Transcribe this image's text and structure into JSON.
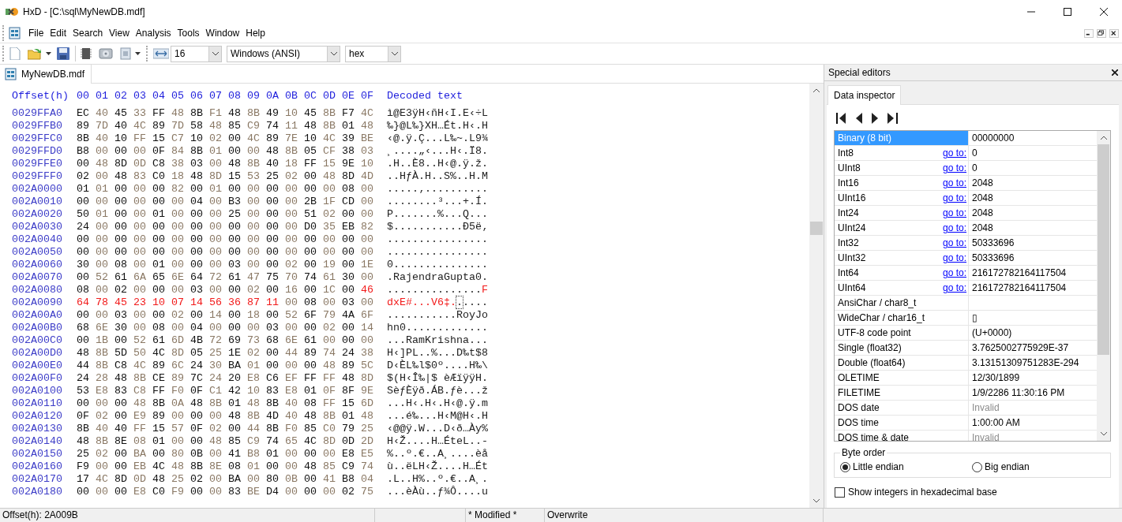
{
  "window": {
    "title": "HxD - [C:\\sql\\MyNewDB.mdf]"
  },
  "menu": [
    "File",
    "Edit",
    "Search",
    "View",
    "Analysis",
    "Tools",
    "Window",
    "Help"
  ],
  "toolbar": {
    "bytes_per_row": "16",
    "encoding": "Windows (ANSI)",
    "display": "hex"
  },
  "document_tabs": [
    {
      "label": "MyNewDB.mdf",
      "selected": true
    }
  ],
  "hex_view": {
    "header": {
      "offset": "Offset(h)",
      "columns": [
        "00",
        "01",
        "02",
        "03",
        "04",
        "05",
        "06",
        "07",
        "08",
        "09",
        "0A",
        "0B",
        "0C",
        "0D",
        "0E",
        "0F"
      ],
      "decoded": "Decoded text"
    },
    "rows": [
      {
        "offset": "0029FFA0",
        "bytes": [
          "EC",
          "40",
          "45",
          "33",
          "FF",
          "48",
          "8B",
          "F1",
          "48",
          "8B",
          "49",
          "10",
          "45",
          "8B",
          "F7",
          "4C"
        ],
        "decoded": [
          {
            "text": "ì@E3ÿH‹ñH‹I.E‹÷L"
          }
        ]
      },
      {
        "offset": "0029FFB0",
        "bytes": [
          "89",
          "7D",
          "40",
          "4C",
          "89",
          "7D",
          "58",
          "48",
          "85",
          "C9",
          "74",
          "11",
          "48",
          "8B",
          "01",
          "48"
        ],
        "decoded": [
          {
            "text": "‰}@L‰}XH…Ét.H‹.H"
          }
        ]
      },
      {
        "offset": "0029FFC0",
        "bytes": [
          "8B",
          "40",
          "10",
          "FF",
          "15",
          "C7",
          "10",
          "02",
          "00",
          "4C",
          "89",
          "7E",
          "10",
          "4C",
          "39",
          "BE"
        ],
        "decoded": [
          {
            "text": "‹@.ÿ.Ç...L‰~.L9¾"
          }
        ]
      },
      {
        "offset": "0029FFD0",
        "bytes": [
          "B8",
          "00",
          "00",
          "00",
          "0F",
          "84",
          "8B",
          "01",
          "00",
          "00",
          "48",
          "8B",
          "05",
          "CF",
          "38",
          "03"
        ],
        "decoded": [
          {
            "text": "¸....„‹...H‹.Ï8."
          }
        ]
      },
      {
        "offset": "0029FFE0",
        "bytes": [
          "00",
          "48",
          "8D",
          "0D",
          "C8",
          "38",
          "03",
          "00",
          "48",
          "8B",
          "40",
          "18",
          "FF",
          "15",
          "9E",
          "10"
        ],
        "decoded": [
          {
            "text": ".H..È8..H‹@.ÿ.ž."
          }
        ]
      },
      {
        "offset": "0029FFF0",
        "bytes": [
          "02",
          "00",
          "48",
          "83",
          "C0",
          "18",
          "48",
          "8D",
          "15",
          "53",
          "25",
          "02",
          "00",
          "48",
          "8D",
          "4D"
        ],
        "decoded": [
          {
            "text": "..HƒÀ.H..S%..H.M"
          }
        ]
      },
      {
        "offset": "002A0000",
        "bytes": [
          "01",
          "01",
          "00",
          "00",
          "00",
          "82",
          "00",
          "01",
          "00",
          "00",
          "00",
          "00",
          "00",
          "00",
          "08",
          "00"
        ],
        "decoded": [
          {
            "text": ".....‚.........."
          }
        ]
      },
      {
        "offset": "002A0010",
        "bytes": [
          "00",
          "00",
          "00",
          "00",
          "00",
          "00",
          "04",
          "00",
          "B3",
          "00",
          "00",
          "00",
          "2B",
          "1F",
          "CD",
          "00"
        ],
        "decoded": [
          {
            "text": "........³...+.Í."
          }
        ]
      },
      {
        "offset": "002A0020",
        "bytes": [
          "50",
          "01",
          "00",
          "00",
          "01",
          "00",
          "00",
          "00",
          "25",
          "00",
          "00",
          "00",
          "51",
          "02",
          "00",
          "00"
        ],
        "decoded": [
          {
            "text": "P.......%...Q..."
          }
        ]
      },
      {
        "offset": "002A0030",
        "bytes": [
          "24",
          "00",
          "00",
          "00",
          "00",
          "00",
          "00",
          "00",
          "00",
          "00",
          "00",
          "00",
          "D0",
          "35",
          "EB",
          "82"
        ],
        "decoded": [
          {
            "text": "$...........Ð5ë‚"
          }
        ]
      },
      {
        "offset": "002A0040",
        "bytes": [
          "00",
          "00",
          "00",
          "00",
          "00",
          "00",
          "00",
          "00",
          "00",
          "00",
          "00",
          "00",
          "00",
          "00",
          "00",
          "00"
        ],
        "decoded": [
          {
            "text": "................"
          }
        ]
      },
      {
        "offset": "002A0050",
        "bytes": [
          "00",
          "00",
          "00",
          "00",
          "00",
          "00",
          "00",
          "00",
          "00",
          "00",
          "00",
          "00",
          "00",
          "00",
          "00",
          "00"
        ],
        "decoded": [
          {
            "text": "................"
          }
        ]
      },
      {
        "offset": "002A0060",
        "bytes": [
          "30",
          "00",
          "08",
          "00",
          "01",
          "00",
          "00",
          "00",
          "03",
          "00",
          "00",
          "02",
          "00",
          "19",
          "00",
          "1E"
        ],
        "decoded": [
          {
            "text": "0..............."
          }
        ]
      },
      {
        "offset": "002A0070",
        "bytes": [
          "00",
          "52",
          "61",
          "6A",
          "65",
          "6E",
          "64",
          "72",
          "61",
          "47",
          "75",
          "70",
          "74",
          "61",
          "30",
          "00"
        ],
        "decoded": [
          {
            "text": ".RajendraGupta0."
          }
        ]
      },
      {
        "offset": "002A0080",
        "bytes": [
          "08",
          "00",
          "02",
          "00",
          "00",
          "00",
          "03",
          "00",
          "00",
          "02",
          "00",
          "16",
          "00",
          "1C",
          "00",
          "46"
        ],
        "modified": [
          false,
          false,
          false,
          false,
          false,
          false,
          false,
          false,
          false,
          false,
          false,
          false,
          false,
          false,
          false,
          true
        ],
        "decoded": [
          {
            "text": "...............",
            "modified": false,
            "cursor": false
          },
          {
            "text": "F",
            "modified": true,
            "cursor": false
          }
        ]
      },
      {
        "offset": "002A0090",
        "bytes": [
          "64",
          "78",
          "45",
          "23",
          "10",
          "07",
          "14",
          "56",
          "36",
          "87",
          "11",
          "00",
          "08",
          "00",
          "03",
          "00"
        ],
        "modified": [
          true,
          true,
          true,
          true,
          true,
          true,
          true,
          true,
          true,
          true,
          true,
          false,
          false,
          false,
          false,
          false
        ],
        "decoded": [
          {
            "text": "dxE#...V6‡.",
            "modified": true,
            "cursor": false
          },
          {
            "text": ".",
            "modified": false,
            "cursor": true
          },
          {
            "text": "....",
            "modified": false,
            "cursor": false
          }
        ]
      },
      {
        "offset": "002A00A0",
        "bytes": [
          "00",
          "00",
          "03",
          "00",
          "00",
          "02",
          "00",
          "14",
          "00",
          "18",
          "00",
          "52",
          "6F",
          "79",
          "4A",
          "6F"
        ],
        "decoded": [
          {
            "text": "...........RoyJo"
          }
        ]
      },
      {
        "offset": "002A00B0",
        "bytes": [
          "68",
          "6E",
          "30",
          "00",
          "08",
          "00",
          "04",
          "00",
          "00",
          "00",
          "03",
          "00",
          "00",
          "02",
          "00",
          "14"
        ],
        "decoded": [
          {
            "text": "hn0............."
          }
        ]
      },
      {
        "offset": "002A00C0",
        "bytes": [
          "00",
          "1B",
          "00",
          "52",
          "61",
          "6D",
          "4B",
          "72",
          "69",
          "73",
          "68",
          "6E",
          "61",
          "00",
          "00",
          "00"
        ],
        "decoded": [
          {
            "text": "...RamKrishna..."
          }
        ]
      },
      {
        "offset": "002A00D0",
        "bytes": [
          "48",
          "8B",
          "5D",
          "50",
          "4C",
          "8D",
          "05",
          "25",
          "1E",
          "02",
          "00",
          "44",
          "89",
          "74",
          "24",
          "38"
        ],
        "decoded": [
          {
            "text": "H‹]PL..%...D‰t$8"
          }
        ]
      },
      {
        "offset": "002A00E0",
        "bytes": [
          "44",
          "8B",
          "C8",
          "4C",
          "89",
          "6C",
          "24",
          "30",
          "BA",
          "01",
          "00",
          "00",
          "00",
          "48",
          "89",
          "5C"
        ],
        "decoded": [
          {
            "text": "D‹ÈL‰l$0º....H‰\\"
          }
        ]
      },
      {
        "offset": "002A00F0",
        "bytes": [
          "24",
          "28",
          "48",
          "8B",
          "CE",
          "89",
          "7C",
          "24",
          "20",
          "E8",
          "C6",
          "EF",
          "FF",
          "FF",
          "48",
          "8D"
        ],
        "decoded": [
          {
            "text": "$(H‹Î‰|$ èÆïÿÿH."
          }
        ]
      },
      {
        "offset": "002A0100",
        "bytes": [
          "53",
          "E8",
          "83",
          "C8",
          "FF",
          "F0",
          "0F",
          "C1",
          "42",
          "10",
          "83",
          "E8",
          "01",
          "0F",
          "8F",
          "9E"
        ],
        "decoded": [
          {
            "text": "SèƒÈÿð.ÁB.ƒè...ž"
          }
        ]
      },
      {
        "offset": "002A0110",
        "bytes": [
          "00",
          "00",
          "00",
          "48",
          "8B",
          "0A",
          "48",
          "8B",
          "01",
          "48",
          "8B",
          "40",
          "08",
          "FF",
          "15",
          "6D"
        ],
        "decoded": [
          {
            "text": "...H‹.H‹.H‹@.ÿ.m"
          }
        ]
      },
      {
        "offset": "002A0120",
        "bytes": [
          "0F",
          "02",
          "00",
          "E9",
          "89",
          "00",
          "00",
          "00",
          "48",
          "8B",
          "4D",
          "40",
          "48",
          "8B",
          "01",
          "48"
        ],
        "decoded": [
          {
            "text": "...é‰...H‹M@H‹.H"
          }
        ]
      },
      {
        "offset": "002A0130",
        "bytes": [
          "8B",
          "40",
          "40",
          "FF",
          "15",
          "57",
          "0F",
          "02",
          "00",
          "44",
          "8B",
          "F0",
          "85",
          "C0",
          "79",
          "25"
        ],
        "decoded": [
          {
            "text": "‹@@ÿ.W...D‹ð…Ày%"
          }
        ]
      },
      {
        "offset": "002A0140",
        "bytes": [
          "48",
          "8B",
          "8E",
          "08",
          "01",
          "00",
          "00",
          "48",
          "85",
          "C9",
          "74",
          "65",
          "4C",
          "8D",
          "0D",
          "2D"
        ],
        "decoded": [
          {
            "text": "H‹Ž....H…ÉteL..-"
          }
        ]
      },
      {
        "offset": "002A0150",
        "bytes": [
          "25",
          "02",
          "00",
          "BA",
          "00",
          "80",
          "0B",
          "00",
          "41",
          "B8",
          "01",
          "00",
          "00",
          "00",
          "E8",
          "E5"
        ],
        "decoded": [
          {
            "text": "%..º.€..A¸....èå"
          }
        ]
      },
      {
        "offset": "002A0160",
        "bytes": [
          "F9",
          "00",
          "00",
          "EB",
          "4C",
          "48",
          "8B",
          "8E",
          "08",
          "01",
          "00",
          "00",
          "48",
          "85",
          "C9",
          "74"
        ],
        "decoded": [
          {
            "text": "ù..ëLH‹Ž....H…Ét"
          }
        ]
      },
      {
        "offset": "002A0170",
        "bytes": [
          "17",
          "4C",
          "8D",
          "0D",
          "48",
          "25",
          "02",
          "00",
          "BA",
          "00",
          "80",
          "0B",
          "00",
          "41",
          "B8",
          "04"
        ],
        "decoded": [
          {
            "text": ".L..H%..º.€..A¸."
          }
        ]
      },
      {
        "offset": "002A0180",
        "bytes": [
          "00",
          "00",
          "00",
          "E8",
          "C0",
          "F9",
          "00",
          "00",
          "83",
          "BE",
          "D4",
          "00",
          "00",
          "00",
          "02",
          "75"
        ],
        "decoded": [
          {
            "text": "...èÀù..ƒ¾Ô....u"
          }
        ]
      }
    ]
  },
  "special_editors": {
    "title": "Special editors",
    "tabs": [
      {
        "label": "Data inspector",
        "selected": true
      }
    ],
    "inspector": [
      {
        "name": "Binary (8 bit)",
        "value": "00000000",
        "selected": true,
        "invalid": false
      },
      {
        "name": "Int8",
        "link": "go to:",
        "value": "0",
        "selected": false,
        "invalid": false
      },
      {
        "name": "UInt8",
        "link": "go to:",
        "value": "0",
        "selected": false,
        "invalid": false
      },
      {
        "name": "Int16",
        "link": "go to:",
        "value": "2048",
        "selected": false,
        "invalid": false
      },
      {
        "name": "UInt16",
        "link": "go to:",
        "value": "2048",
        "selected": false,
        "invalid": false
      },
      {
        "name": "Int24",
        "link": "go to:",
        "value": "2048",
        "selected": false,
        "invalid": false
      },
      {
        "name": "UInt24",
        "link": "go to:",
        "value": "2048",
        "selected": false,
        "invalid": false
      },
      {
        "name": "Int32",
        "link": "go to:",
        "value": "50333696",
        "selected": false,
        "invalid": false
      },
      {
        "name": "UInt32",
        "link": "go to:",
        "value": "50333696",
        "selected": false,
        "invalid": false
      },
      {
        "name": "Int64",
        "link": "go to:",
        "value": "216172782164117504",
        "selected": false,
        "invalid": false
      },
      {
        "name": "UInt64",
        "link": "go to:",
        "value": "216172782164117504",
        "selected": false,
        "invalid": false
      },
      {
        "name": "AnsiChar / char8_t",
        "selected": false
      },
      {
        "name": "WideChar / char16_t",
        "value": "▯",
        "selected": false,
        "invalid": false
      },
      {
        "name": "UTF-8 code point",
        "value": "(U+0000)",
        "selected": false,
        "invalid": false
      },
      {
        "name": "Single (float32)",
        "value": "3.7625002775929E-37",
        "selected": false,
        "invalid": false
      },
      {
        "name": "Double (float64)",
        "value": "3.13151309751283E-294",
        "selected": false,
        "invalid": false
      },
      {
        "name": "OLETIME",
        "value": "12/30/1899",
        "selected": false,
        "invalid": false
      },
      {
        "name": "FILETIME",
        "value": "1/9/2286 11:30:16 PM",
        "selected": false,
        "invalid": false
      },
      {
        "name": "DOS date",
        "value": "Invalid",
        "selected": false,
        "invalid": true
      },
      {
        "name": "DOS time",
        "value": "1:00:00 AM",
        "selected": false,
        "invalid": false
      },
      {
        "name": "DOS time & date",
        "value": "Invalid",
        "selected": false,
        "invalid": true
      }
    ],
    "byte_order": {
      "legend": "Byte order",
      "options": [
        {
          "label": "Little endian",
          "selected": true
        },
        {
          "label": "Big endian",
          "selected": false
        }
      ]
    },
    "hex_integers": {
      "label": "Show integers in hexadecimal base",
      "checked": false
    }
  },
  "status_bar": {
    "offset": "Offset(h): 2A009B",
    "modified": "* Modified *",
    "mode": "Overwrite"
  }
}
